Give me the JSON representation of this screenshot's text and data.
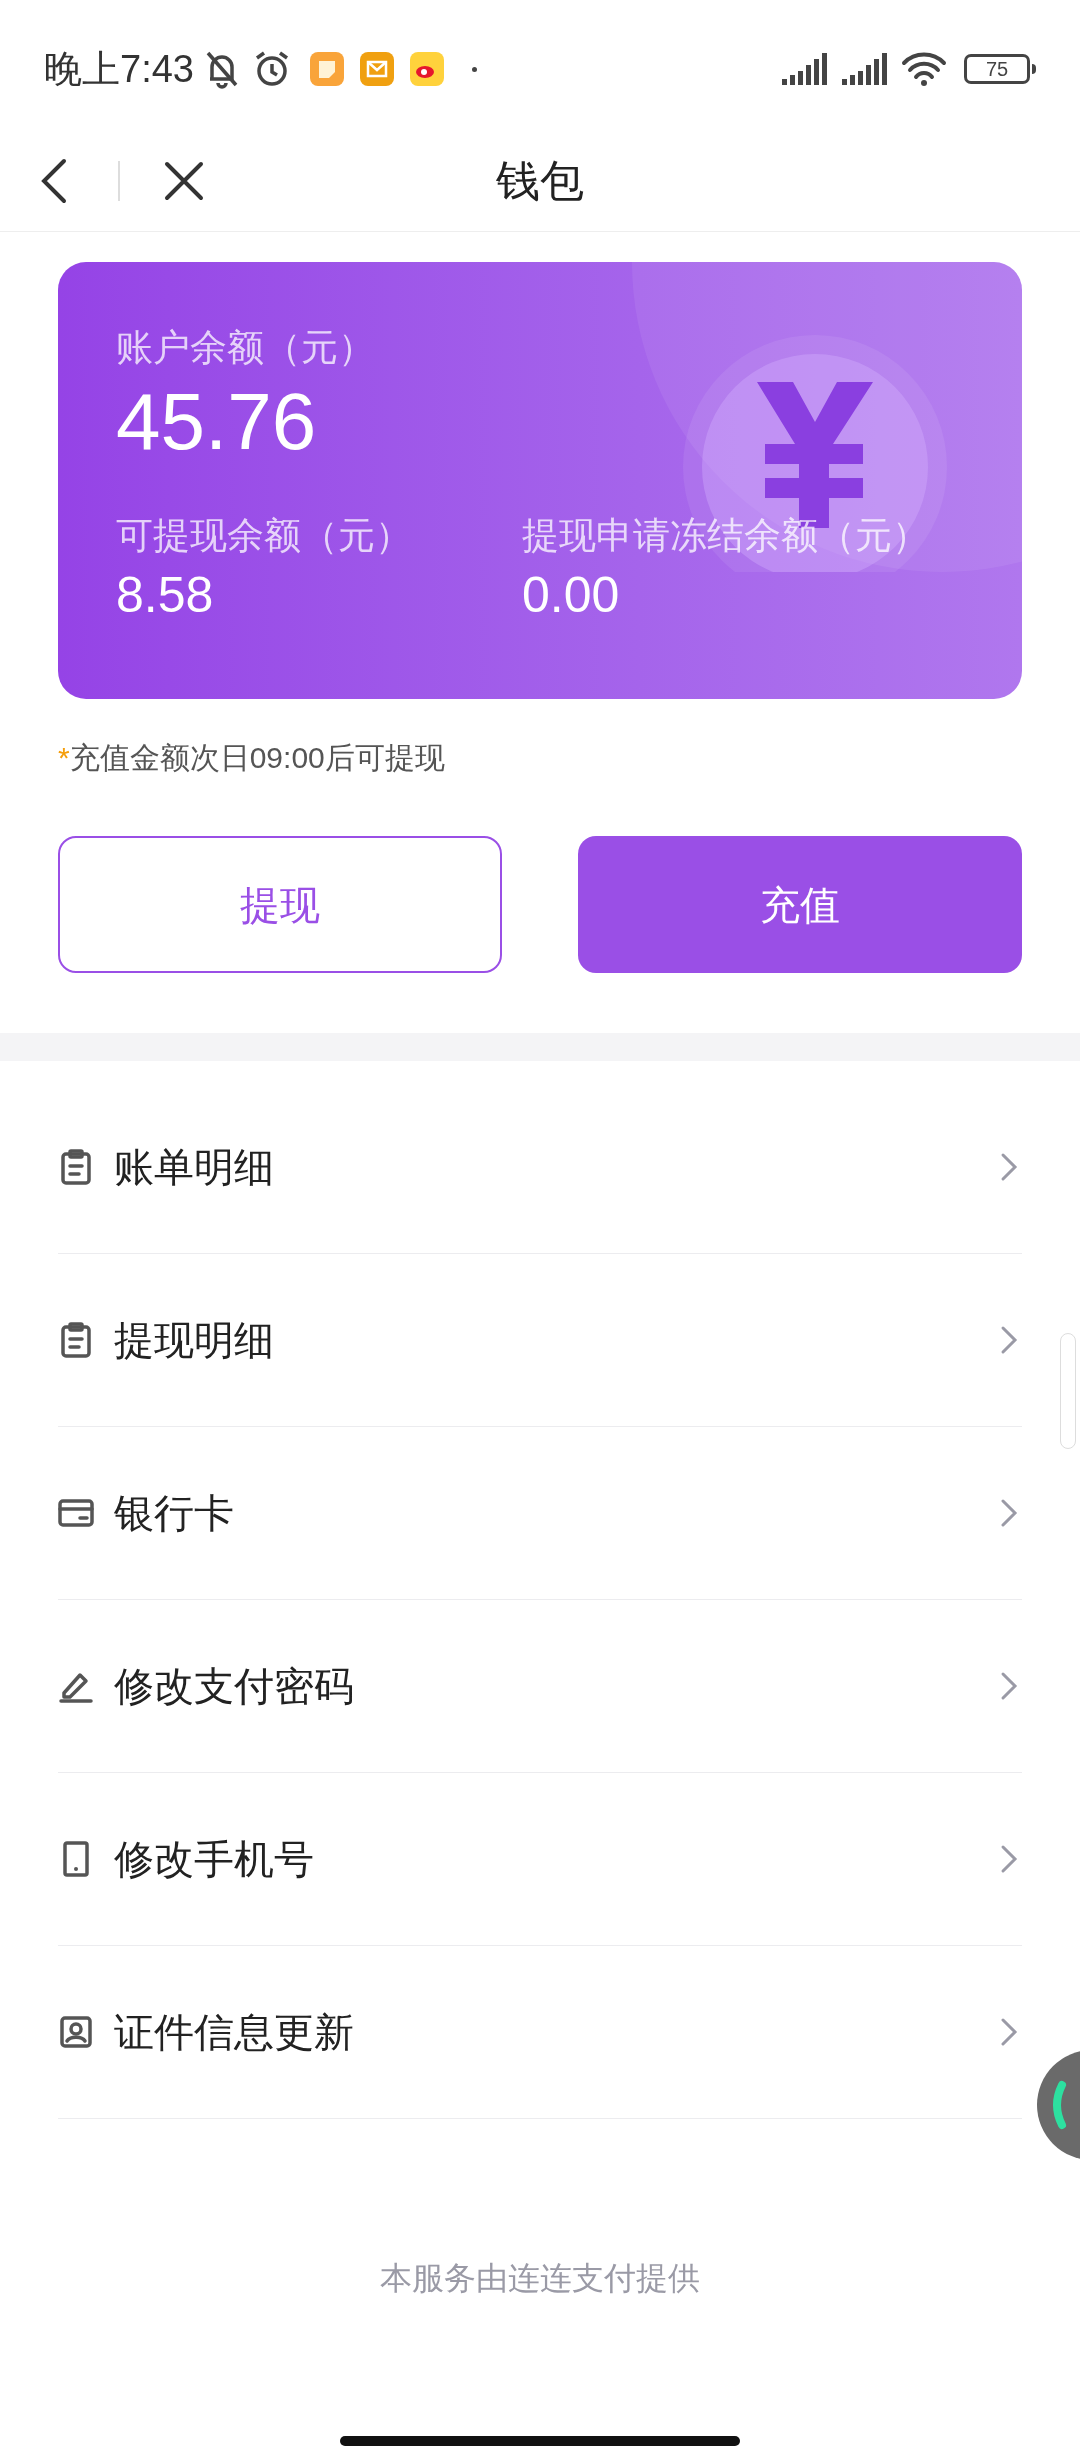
{
  "status_bar": {
    "time": "晚上7:43",
    "battery": "75"
  },
  "nav": {
    "title": "钱包"
  },
  "card": {
    "balance_label": "账户余额（元）",
    "balance": "45.76",
    "withdrawable_label": "可提现余额（元）",
    "withdrawable": "8.58",
    "frozen_label": "提现申请冻结余额（元）",
    "frozen": "0.00"
  },
  "note": {
    "mark": "*",
    "text": "充值金额次日09:00后可提现"
  },
  "buttons": [
    {
      "label": "提现",
      "kind": "outline"
    },
    {
      "label": "充值",
      "kind": "filled"
    }
  ],
  "menu": [
    {
      "label": "账单明细",
      "kind": "clipboard"
    },
    {
      "label": "提现明细",
      "kind": "clipboard"
    },
    {
      "label": "银行卡",
      "kind": "card"
    },
    {
      "label": "修改支付密码",
      "kind": "pencil"
    },
    {
      "label": "修改手机号",
      "kind": "phone"
    },
    {
      "label": "证件信息更新",
      "kind": "id"
    }
  ],
  "footer": "本服务由连连支付提供"
}
